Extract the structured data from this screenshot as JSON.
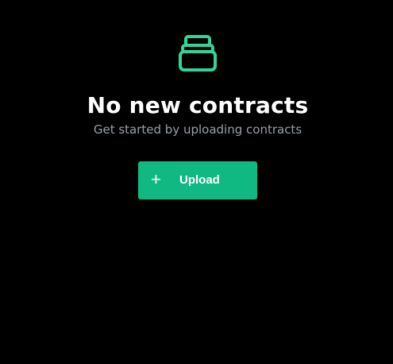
{
  "empty_state": {
    "icon": "stacked-box-icon",
    "title": "No new contracts",
    "subtitle": "Get started by uploading contracts"
  },
  "upload_button": {
    "icon": "plus-icon",
    "icon_glyph": "+",
    "label": "Upload"
  },
  "colors": {
    "background": "#000000",
    "accent": "#10b981",
    "icon_stroke": "#34d399",
    "title": "#ffffff",
    "subtitle": "#9aa0a8"
  }
}
